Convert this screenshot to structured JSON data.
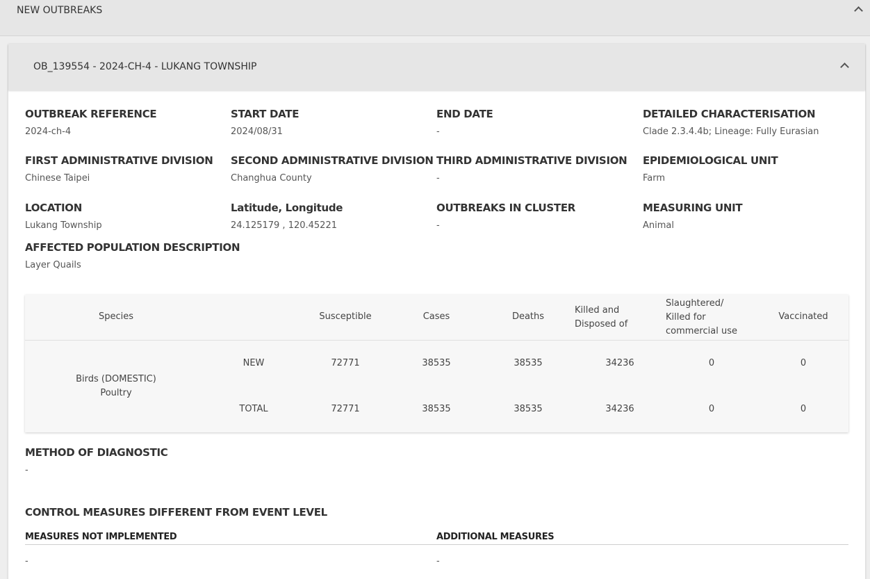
{
  "top": {
    "title": "NEW OUTBREAKS"
  },
  "outbreak": {
    "title": "OB_139554 - 2024-CH-4 - LUKANG TOWNSHIP",
    "fields": [
      {
        "label": "OUTBREAK REFERENCE",
        "value": "2024-ch-4"
      },
      {
        "label": "START DATE",
        "value": "2024/08/31"
      },
      {
        "label": "END DATE",
        "value": "-"
      },
      {
        "label": "DETAILED CHARACTERISATION",
        "value": "Clade 2.3.4.4b; Lineage: Fully Eurasian"
      },
      {
        "label": "FIRST ADMINISTRATIVE DIVISION",
        "value": "Chinese Taipei"
      },
      {
        "label": "SECOND ADMINISTRATIVE DIVISION",
        "value": "Changhua County"
      },
      {
        "label": "THIRD ADMINISTRATIVE DIVISION",
        "value": "-"
      },
      {
        "label": "EPIDEMIOLOGICAL UNIT",
        "value": "Farm"
      },
      {
        "label": "LOCATION",
        "value": "Lukang Township"
      },
      {
        "label": "Latitude, Longitude",
        "value": "24.125179 , 120.45221"
      },
      {
        "label": "OUTBREAKS IN CLUSTER",
        "value": "-"
      },
      {
        "label": "MEASURING UNIT",
        "value": "Animal"
      },
      {
        "label": "AFFECTED POPULATION DESCRIPTION",
        "value": "Layer Quails"
      }
    ],
    "table": {
      "headers": {
        "species": "Species",
        "susceptible": "Susceptible",
        "cases": "Cases",
        "deaths": "Deaths",
        "killed_1": "Killed and",
        "killed_2": "Disposed of",
        "slaughtered_1": "Slaughtered/",
        "slaughtered_2": "Killed for",
        "slaughtered_3": "commercial use",
        "vaccinated": "Vaccinated"
      },
      "species_line1": "Birds (DOMESTIC)",
      "species_line2": "Poultry",
      "rows": [
        {
          "type": "NEW",
          "susceptible": "72771",
          "cases": "38535",
          "deaths": "38535",
          "killed": "34236",
          "slaughtered": "0",
          "vaccinated": "0"
        },
        {
          "type": "TOTAL",
          "susceptible": "72771",
          "cases": "38535",
          "deaths": "38535",
          "killed": "34236",
          "slaughtered": "0",
          "vaccinated": "0"
        }
      ]
    },
    "diagnostic": {
      "label": "METHOD OF DIAGNOSTIC",
      "value": "-"
    },
    "control": {
      "label": "CONTROL MEASURES DIFFERENT FROM EVENT LEVEL",
      "not_implemented_label": "MEASURES NOT IMPLEMENTED",
      "not_implemented_value": "-",
      "additional_label": "ADDITIONAL MEASURES",
      "additional_value": "-"
    }
  }
}
